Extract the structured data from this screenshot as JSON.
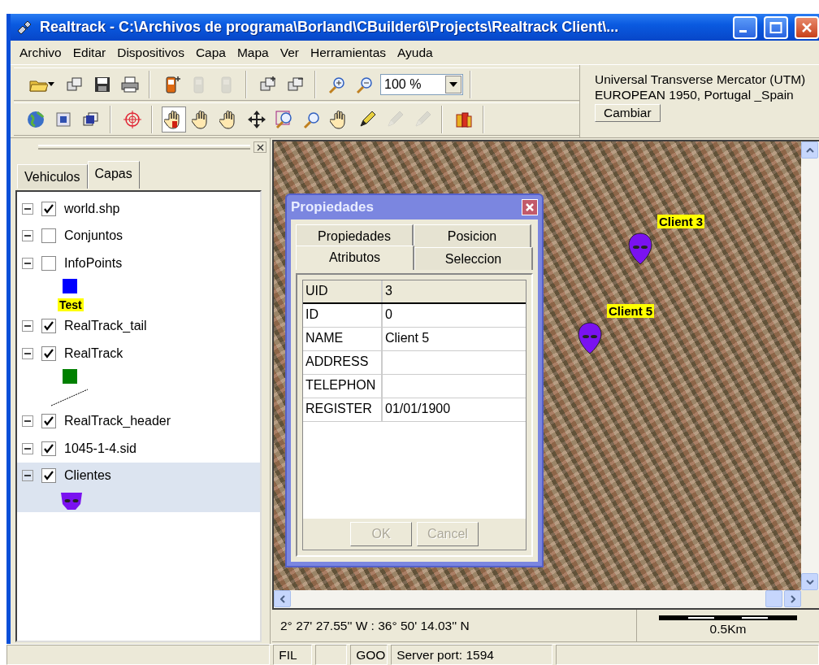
{
  "window": {
    "title": "Realtrack - C:\\Archivos de programa\\Borland\\CBuilder6\\Projects\\Realtrack Client\\..."
  },
  "menu": [
    "Archivo",
    "Editar",
    "Dispositivos",
    "Capa",
    "Mapa",
    "Ver",
    "Herramientas",
    "Ayuda"
  ],
  "toolbars": [
    {
      "groups": [
        {
          "buttons": [
            {
              "kind": "open-folder",
              "disabled": false,
              "selected": false
            },
            {
              "kind": "layers",
              "disabled": false,
              "selected": false
            },
            {
              "kind": "save",
              "disabled": false,
              "selected": false
            },
            {
              "kind": "print",
              "disabled": false,
              "selected": false
            }
          ]
        },
        {
          "buttons": [
            {
              "kind": "device-add",
              "disabled": false,
              "selected": false
            },
            {
              "kind": "device",
              "disabled": true,
              "selected": false
            },
            {
              "kind": "device",
              "disabled": true,
              "selected": false
            }
          ]
        },
        {
          "buttons": [
            {
              "kind": "layer-add",
              "disabled": false,
              "selected": false
            },
            {
              "kind": "layer-remove",
              "disabled": false,
              "selected": false
            }
          ]
        },
        {
          "buttons": [
            {
              "kind": "zoom-in",
              "disabled": false,
              "selected": false
            },
            {
              "kind": "zoom-out",
              "disabled": false,
              "selected": false
            }
          ],
          "zoom": {
            "value": "100 %"
          }
        }
      ]
    },
    {
      "groups": [
        {
          "buttons": [
            {
              "kind": "globe",
              "disabled": false,
              "selected": false
            },
            {
              "kind": "map",
              "disabled": false,
              "selected": false
            },
            {
              "kind": "map-layers",
              "disabled": false,
              "selected": false
            }
          ]
        },
        {
          "buttons": [
            {
              "kind": "target",
              "disabled": false,
              "selected": false
            }
          ]
        },
        {
          "buttons": [
            {
              "kind": "hand-info",
              "disabled": false,
              "selected": true
            },
            {
              "kind": "hand",
              "disabled": false,
              "selected": false
            },
            {
              "kind": "hand-select",
              "disabled": false,
              "selected": false
            },
            {
              "kind": "move",
              "disabled": false,
              "selected": false
            },
            {
              "kind": "zoom-box",
              "disabled": false,
              "selected": false
            },
            {
              "kind": "magnifier",
              "disabled": false,
              "selected": false
            },
            {
              "kind": "grab",
              "disabled": false,
              "selected": false
            },
            {
              "kind": "pencil",
              "disabled": false,
              "selected": false
            },
            {
              "kind": "pencil",
              "disabled": true,
              "selected": false
            },
            {
              "kind": "pencil",
              "disabled": true,
              "selected": false
            }
          ]
        },
        {
          "buttons": [
            {
              "kind": "books",
              "disabled": false,
              "selected": false
            }
          ]
        }
      ]
    }
  ],
  "projection": {
    "lines": [
      "Universal Transverse Mercator (UTM)",
      "EUROPEAN 1950, Portugal _Spain"
    ],
    "button": "Cambiar"
  },
  "left_panel": {
    "tabs": [
      {
        "label": "Vehiculos",
        "selected": false
      },
      {
        "label": "Capas",
        "selected": true
      }
    ],
    "layers": [
      {
        "label": "world.shp",
        "checked": true,
        "expanded": true,
        "selected": false
      },
      {
        "label": "Conjuntos",
        "checked": false,
        "expanded": true,
        "selected": false
      },
      {
        "label": "InfoPoints",
        "checked": false,
        "expanded": true,
        "selected": false,
        "children": [
          {
            "kind": "swatch",
            "color": "#0000ff"
          },
          {
            "kind": "tag",
            "text": "Test"
          }
        ]
      },
      {
        "label": "RealTrack_tail",
        "checked": true,
        "expanded": true,
        "selected": false
      },
      {
        "label": "RealTrack",
        "checked": true,
        "expanded": true,
        "selected": false,
        "children": [
          {
            "kind": "swatch",
            "color": "#008000"
          },
          {
            "kind": "line"
          }
        ]
      },
      {
        "label": "RealTrack_header",
        "checked": true,
        "expanded": true,
        "selected": false
      },
      {
        "label": "1045-1-4.sid",
        "checked": true,
        "expanded": true,
        "selected": false
      },
      {
        "label": "Clientes",
        "checked": true,
        "expanded": true,
        "selected": true,
        "children": [
          {
            "kind": "marker"
          }
        ]
      }
    ]
  },
  "map": {
    "markers": [
      {
        "label": "Client 3"
      },
      {
        "label": "Client 5"
      }
    ],
    "coordinates": "2° 27' 27.55'' W : 36° 50' 14.03'' N",
    "scale": "0.5Km"
  },
  "dialog": {
    "title": "Propiedades",
    "tab_rows": [
      [
        {
          "label": "Propiedades",
          "selected": false
        },
        {
          "label": "Posicion",
          "selected": false
        }
      ],
      [
        {
          "label": "Atributos",
          "selected": true
        },
        {
          "label": "Seleccion",
          "selected": false
        }
      ]
    ],
    "rows": [
      {
        "kind": "fixed",
        "field": "UID",
        "value": "3"
      },
      {
        "kind": "data",
        "field": "ID",
        "value": "0"
      },
      {
        "kind": "data",
        "field": "NAME",
        "value": "Client 5"
      },
      {
        "kind": "data",
        "field": "ADDRESS"
      },
      {
        "kind": "data",
        "field": "TELEPHON"
      },
      {
        "kind": "data",
        "field": "REGISTER",
        "value": "01/01/1900"
      }
    ],
    "buttons": [
      {
        "label": "OK",
        "disabled": true
      },
      {
        "label": "Cancel",
        "disabled": true
      }
    ]
  },
  "status_bar": {
    "panels": [
      {
        "kind": "empty"
      },
      {
        "kind": "text",
        "text": "FIL"
      },
      {
        "kind": "empty"
      },
      {
        "kind": "text",
        "text": "GOO"
      },
      {
        "kind": "text",
        "text": "Server port: 1594"
      },
      {
        "kind": "empty"
      }
    ]
  }
}
